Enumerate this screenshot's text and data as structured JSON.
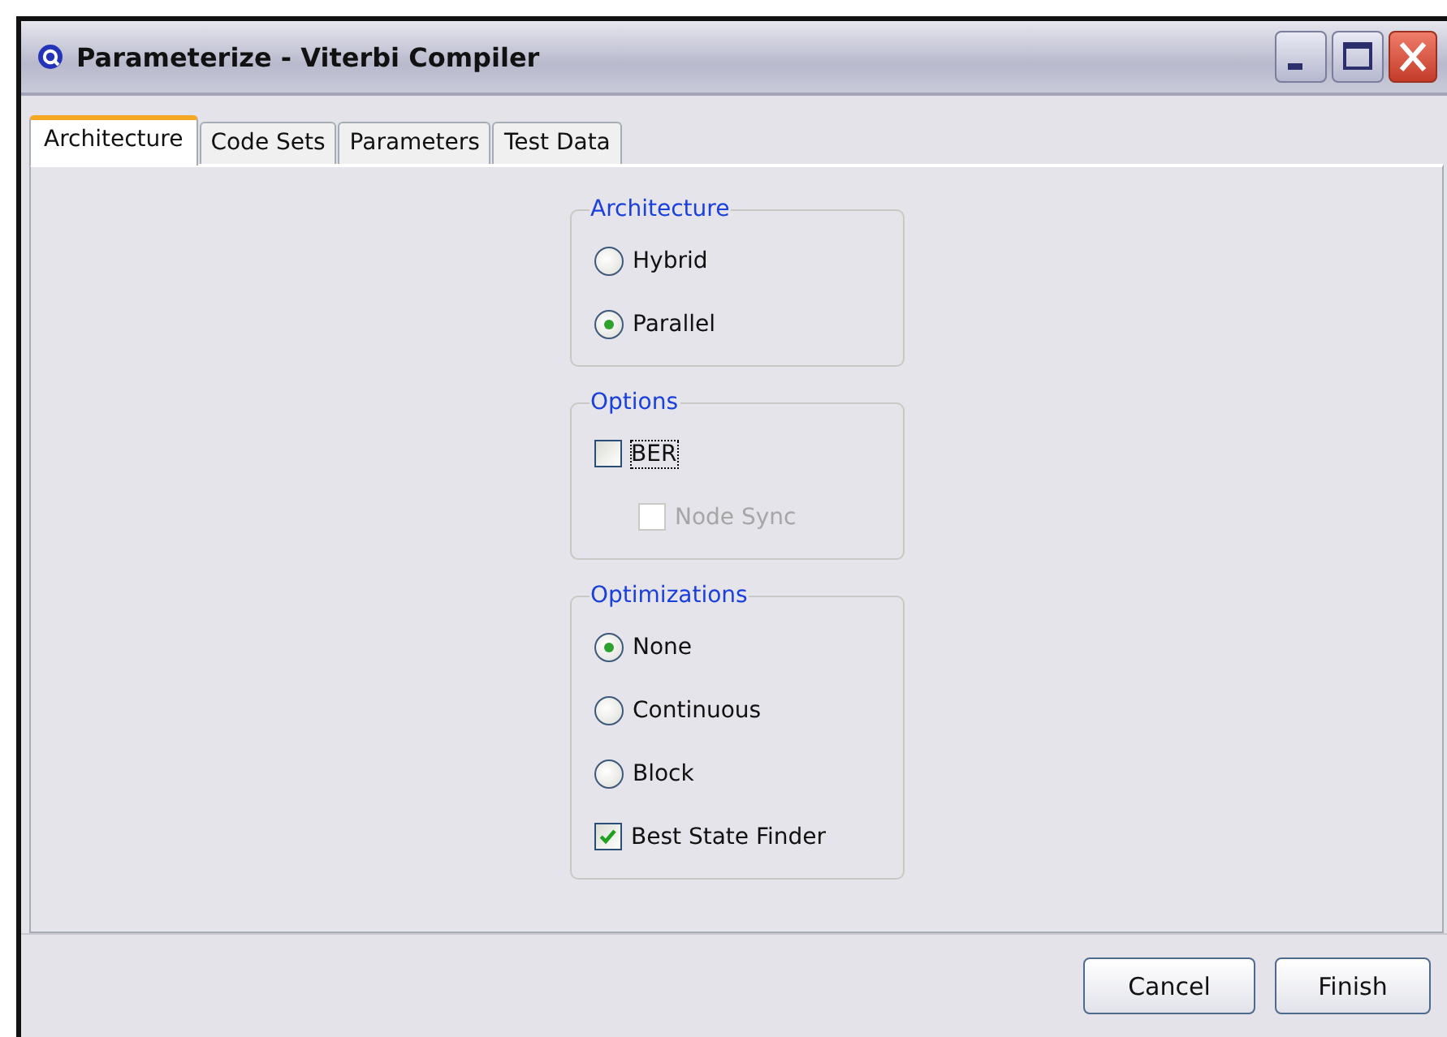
{
  "window": {
    "title": "Parameterize - Viterbi Compiler"
  },
  "tabs": [
    {
      "label": "Architecture",
      "selected": true
    },
    {
      "label": "Code Sets",
      "selected": false
    },
    {
      "label": "Parameters",
      "selected": false
    },
    {
      "label": "Test Data",
      "selected": false
    }
  ],
  "groups": [
    {
      "title": "Architecture",
      "items": [
        {
          "kind": "radio",
          "label": "Hybrid",
          "selected": false,
          "disabled": false,
          "focused": false
        },
        {
          "kind": "radio",
          "label": "Parallel",
          "selected": true,
          "disabled": false,
          "focused": false
        }
      ]
    },
    {
      "title": "Options",
      "items": [
        {
          "kind": "checkbox",
          "label": "BER",
          "checked": false,
          "disabled": false,
          "focused": true,
          "children": [
            {
              "kind": "checkbox",
              "label": "Node Sync",
              "checked": false,
              "disabled": true,
              "focused": false
            }
          ]
        }
      ]
    },
    {
      "title": "Optimizations",
      "items": [
        {
          "kind": "radio",
          "label": "None",
          "selected": true,
          "disabled": false,
          "focused": false
        },
        {
          "kind": "radio",
          "label": "Continuous",
          "selected": false,
          "disabled": false,
          "focused": false
        },
        {
          "kind": "radio",
          "label": "Block",
          "selected": false,
          "disabled": false,
          "focused": false
        },
        {
          "kind": "checkbox",
          "label": "Best State Finder",
          "checked": true,
          "disabled": false,
          "focused": false
        }
      ]
    }
  ],
  "buttons": [
    "Cancel",
    "Finish"
  ]
}
